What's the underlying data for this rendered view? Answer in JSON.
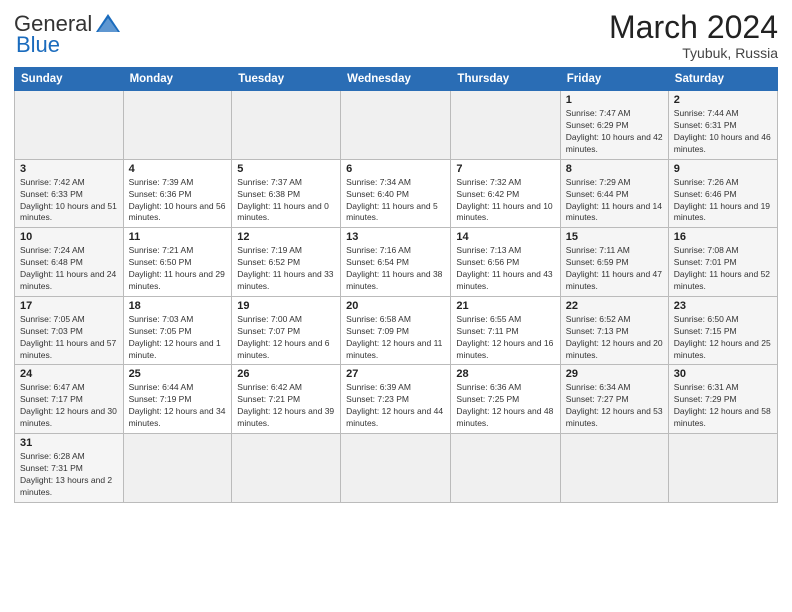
{
  "logo": {
    "general": "General",
    "blue": "Blue"
  },
  "title": "March 2024",
  "subtitle": "Tyubuk, Russia",
  "days_header": [
    "Sunday",
    "Monday",
    "Tuesday",
    "Wednesday",
    "Thursday",
    "Friday",
    "Saturday"
  ],
  "weeks": [
    [
      {
        "day": "",
        "info": ""
      },
      {
        "day": "",
        "info": ""
      },
      {
        "day": "",
        "info": ""
      },
      {
        "day": "",
        "info": ""
      },
      {
        "day": "",
        "info": ""
      },
      {
        "day": "1",
        "info": "Sunrise: 7:47 AM\nSunset: 6:29 PM\nDaylight: 10 hours and 42 minutes."
      },
      {
        "day": "2",
        "info": "Sunrise: 7:44 AM\nSunset: 6:31 PM\nDaylight: 10 hours and 46 minutes."
      }
    ],
    [
      {
        "day": "3",
        "info": "Sunrise: 7:42 AM\nSunset: 6:33 PM\nDaylight: 10 hours and 51 minutes."
      },
      {
        "day": "4",
        "info": "Sunrise: 7:39 AM\nSunset: 6:36 PM\nDaylight: 10 hours and 56 minutes."
      },
      {
        "day": "5",
        "info": "Sunrise: 7:37 AM\nSunset: 6:38 PM\nDaylight: 11 hours and 0 minutes."
      },
      {
        "day": "6",
        "info": "Sunrise: 7:34 AM\nSunset: 6:40 PM\nDaylight: 11 hours and 5 minutes."
      },
      {
        "day": "7",
        "info": "Sunrise: 7:32 AM\nSunset: 6:42 PM\nDaylight: 11 hours and 10 minutes."
      },
      {
        "day": "8",
        "info": "Sunrise: 7:29 AM\nSunset: 6:44 PM\nDaylight: 11 hours and 14 minutes."
      },
      {
        "day": "9",
        "info": "Sunrise: 7:26 AM\nSunset: 6:46 PM\nDaylight: 11 hours and 19 minutes."
      }
    ],
    [
      {
        "day": "10",
        "info": "Sunrise: 7:24 AM\nSunset: 6:48 PM\nDaylight: 11 hours and 24 minutes."
      },
      {
        "day": "11",
        "info": "Sunrise: 7:21 AM\nSunset: 6:50 PM\nDaylight: 11 hours and 29 minutes."
      },
      {
        "day": "12",
        "info": "Sunrise: 7:19 AM\nSunset: 6:52 PM\nDaylight: 11 hours and 33 minutes."
      },
      {
        "day": "13",
        "info": "Sunrise: 7:16 AM\nSunset: 6:54 PM\nDaylight: 11 hours and 38 minutes."
      },
      {
        "day": "14",
        "info": "Sunrise: 7:13 AM\nSunset: 6:56 PM\nDaylight: 11 hours and 43 minutes."
      },
      {
        "day": "15",
        "info": "Sunrise: 7:11 AM\nSunset: 6:59 PM\nDaylight: 11 hours and 47 minutes."
      },
      {
        "day": "16",
        "info": "Sunrise: 7:08 AM\nSunset: 7:01 PM\nDaylight: 11 hours and 52 minutes."
      }
    ],
    [
      {
        "day": "17",
        "info": "Sunrise: 7:05 AM\nSunset: 7:03 PM\nDaylight: 11 hours and 57 minutes."
      },
      {
        "day": "18",
        "info": "Sunrise: 7:03 AM\nSunset: 7:05 PM\nDaylight: 12 hours and 1 minute."
      },
      {
        "day": "19",
        "info": "Sunrise: 7:00 AM\nSunset: 7:07 PM\nDaylight: 12 hours and 6 minutes."
      },
      {
        "day": "20",
        "info": "Sunrise: 6:58 AM\nSunset: 7:09 PM\nDaylight: 12 hours and 11 minutes."
      },
      {
        "day": "21",
        "info": "Sunrise: 6:55 AM\nSunset: 7:11 PM\nDaylight: 12 hours and 16 minutes."
      },
      {
        "day": "22",
        "info": "Sunrise: 6:52 AM\nSunset: 7:13 PM\nDaylight: 12 hours and 20 minutes."
      },
      {
        "day": "23",
        "info": "Sunrise: 6:50 AM\nSunset: 7:15 PM\nDaylight: 12 hours and 25 minutes."
      }
    ],
    [
      {
        "day": "24",
        "info": "Sunrise: 6:47 AM\nSunset: 7:17 PM\nDaylight: 12 hours and 30 minutes."
      },
      {
        "day": "25",
        "info": "Sunrise: 6:44 AM\nSunset: 7:19 PM\nDaylight: 12 hours and 34 minutes."
      },
      {
        "day": "26",
        "info": "Sunrise: 6:42 AM\nSunset: 7:21 PM\nDaylight: 12 hours and 39 minutes."
      },
      {
        "day": "27",
        "info": "Sunrise: 6:39 AM\nSunset: 7:23 PM\nDaylight: 12 hours and 44 minutes."
      },
      {
        "day": "28",
        "info": "Sunrise: 6:36 AM\nSunset: 7:25 PM\nDaylight: 12 hours and 48 minutes."
      },
      {
        "day": "29",
        "info": "Sunrise: 6:34 AM\nSunset: 7:27 PM\nDaylight: 12 hours and 53 minutes."
      },
      {
        "day": "30",
        "info": "Sunrise: 6:31 AM\nSunset: 7:29 PM\nDaylight: 12 hours and 58 minutes."
      }
    ],
    [
      {
        "day": "31",
        "info": "Sunrise: 6:28 AM\nSunset: 7:31 PM\nDaylight: 13 hours and 2 minutes."
      },
      {
        "day": "",
        "info": ""
      },
      {
        "day": "",
        "info": ""
      },
      {
        "day": "",
        "info": ""
      },
      {
        "day": "",
        "info": ""
      },
      {
        "day": "",
        "info": ""
      },
      {
        "day": "",
        "info": ""
      }
    ]
  ]
}
